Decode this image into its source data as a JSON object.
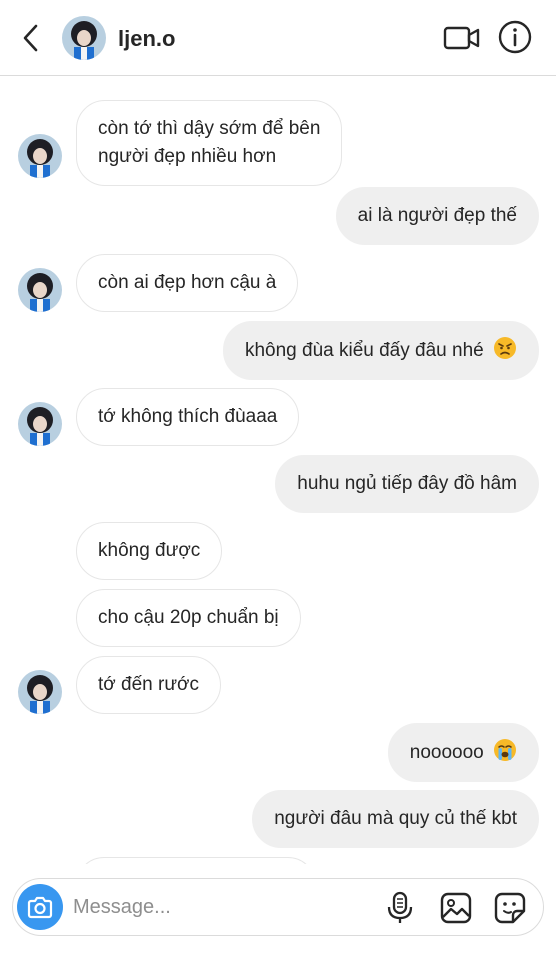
{
  "header": {
    "username": "ljen.o",
    "icons": {
      "back": "chevron-left-icon",
      "video": "video-camera-icon",
      "info": "info-icon"
    }
  },
  "messages": [
    {
      "side": "in",
      "lines": [
        "còn tớ thì dậy sớm để bên",
        "người đẹp nhiều hơn"
      ],
      "avatar": true
    },
    {
      "side": "out",
      "lines": [
        "ai là người đẹp thế"
      ]
    },
    {
      "side": "in",
      "lines": [
        "còn ai đẹp hơn cậu à"
      ],
      "avatar": true
    },
    {
      "side": "out",
      "lines": [
        "không đùa kiểu đấy đâu nhé"
      ],
      "emoji": "angry-face"
    },
    {
      "side": "in",
      "lines": [
        "tớ không thích đùaaa"
      ],
      "avatar": true
    },
    {
      "side": "out",
      "lines": [
        "huhu ngủ tiếp đây đồ hâm"
      ]
    },
    {
      "side": "in",
      "lines": [
        "không được"
      ]
    },
    {
      "side": "in",
      "lines": [
        "cho cậu 20p chuẩn bị"
      ]
    },
    {
      "side": "in",
      "lines": [
        "tớ đến rước"
      ],
      "avatar": true
    },
    {
      "side": "out",
      "lines": [
        "noooooo"
      ],
      "emoji": "crying-face"
    },
    {
      "side": "out",
      "lines": [
        "người đâu mà quy củ thế kbt"
      ]
    }
  ],
  "composer": {
    "placeholder": "Message...",
    "icons": {
      "camera": "camera-icon",
      "mic": "microphone-icon",
      "gallery": "gallery-icon",
      "sticker": "sticker-icon"
    }
  },
  "colors": {
    "accent": "#3897f0",
    "outgoing_bubble": "#efefef",
    "incoming_border": "#e6e6e6"
  }
}
